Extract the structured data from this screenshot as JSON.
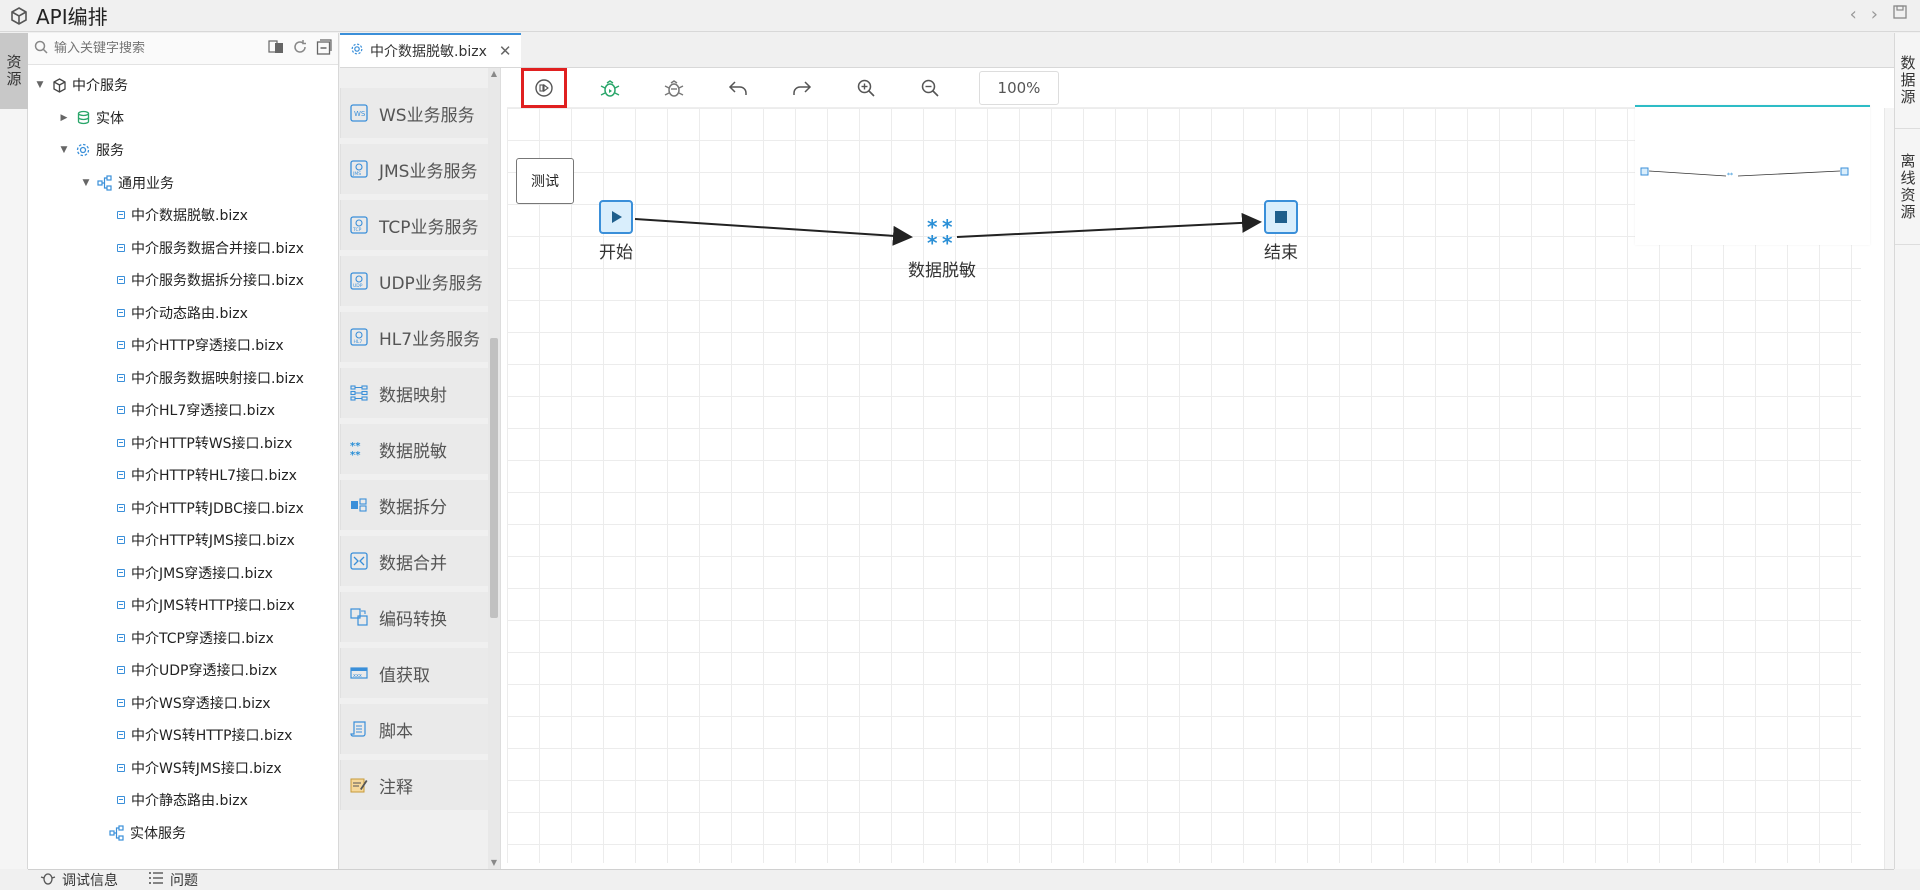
{
  "app": {
    "title": "API编排"
  },
  "left_rail": {
    "tab": "资源"
  },
  "right_rail": {
    "tabs": [
      "数据源",
      "离线资源"
    ]
  },
  "search": {
    "placeholder": "输入关键字搜索"
  },
  "tree": {
    "root": "中介服务",
    "entity": "实体",
    "service": "服务",
    "general": "通用业务",
    "files": [
      "中介数据脱敏.bizx",
      "中介服务数据合并接口.bizx",
      "中介服务数据拆分接口.bizx",
      "中介动态路由.bizx",
      "中介HTTP穿透接口.bizx",
      "中介服务数据映射接口.bizx",
      "中介HL7穿透接口.bizx",
      "中介HTTP转WS接口.bizx",
      "中介HTTP转HL7接口.bizx",
      "中介HTTP转JDBC接口.bizx",
      "中介HTTP转JMS接口.bizx",
      "中介JMS穿透接口.bizx",
      "中介JMS转HTTP接口.bizx",
      "中介TCP穿透接口.bizx",
      "中介UDP穿透接口.bizx",
      "中介WS穿透接口.bizx",
      "中介WS转HTTP接口.bizx",
      "中介WS转JMS接口.bizx",
      "中介静态路由.bizx"
    ],
    "entity_service": "实体服务"
  },
  "editor_tab": {
    "label": "中介数据脱敏.bizx"
  },
  "palette": [
    {
      "label": "WS业务服务",
      "icon": "ws-icon"
    },
    {
      "label": "JMS业务服务",
      "icon": "jms-icon"
    },
    {
      "label": "TCP业务服务",
      "icon": "tcp-icon"
    },
    {
      "label": "UDP业务服务",
      "icon": "udp-icon"
    },
    {
      "label": "HL7业务服务",
      "icon": "hl7-icon"
    },
    {
      "label": "数据映射",
      "icon": "mapping-icon"
    },
    {
      "label": "数据脱敏",
      "icon": "masking-icon"
    },
    {
      "label": "数据拆分",
      "icon": "split-icon"
    },
    {
      "label": "数据合并",
      "icon": "merge-icon"
    },
    {
      "label": "编码转换",
      "icon": "encode-icon"
    },
    {
      "label": "值获取",
      "icon": "value-icon"
    },
    {
      "label": "脚本",
      "icon": "script-icon"
    },
    {
      "label": "注释",
      "icon": "note-icon"
    }
  ],
  "toolbar": {
    "zoom": "100%",
    "tooltip": "测试"
  },
  "flow": {
    "start": "开始",
    "mask": "数据脱敏",
    "end": "结束"
  },
  "bottom": {
    "debug": "调试信息",
    "problems": "问题"
  },
  "colors": {
    "accent": "#3a8fd9",
    "highlight": "#e02020",
    "minimap": "#2dbcc6"
  }
}
